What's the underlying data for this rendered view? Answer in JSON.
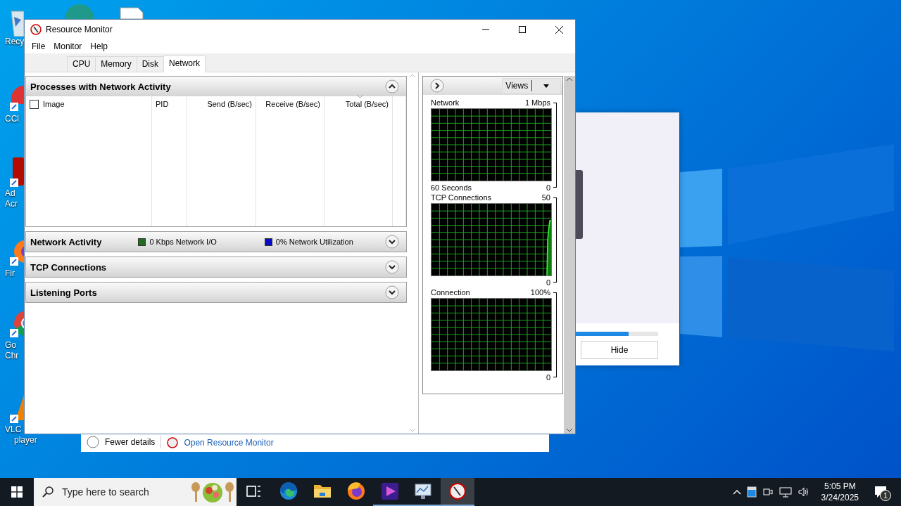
{
  "desktop_icons": [
    {
      "kind": "recycle",
      "lines": [
        "Recy"
      ]
    },
    {
      "kind": "ccleaner",
      "lines": [
        "CCl"
      ]
    },
    {
      "kind": "acrobat",
      "lines": [
        "Ad",
        "Acr"
      ]
    },
    {
      "kind": "firefox",
      "lines": [
        "Fir"
      ]
    },
    {
      "kind": "chrome",
      "lines": [
        "Go",
        "Chr"
      ]
    },
    {
      "kind": "vlc",
      "lines": [
        "VLC",
        "player"
      ]
    }
  ],
  "task_manager": {
    "fewer_details": "Fewer details",
    "link": "Open Resource Monitor"
  },
  "popup": {
    "progress": {
      "level": 0.64
    },
    "hide_button": "Hide"
  },
  "window": {
    "title": "Resource Monitor",
    "menu": [
      "File",
      "Monitor",
      "Help"
    ],
    "tabs": [
      {
        "label": "CPU",
        "selected": false
      },
      {
        "label": "Memory",
        "selected": false
      },
      {
        "label": "Disk",
        "selected": false
      },
      {
        "label": "Network",
        "selected": true
      }
    ]
  },
  "sections": [
    {
      "title": "Processes with Network Activity",
      "expanded": true,
      "select_all_checked": false,
      "columns": [
        {
          "label": "Image",
          "sorted": false
        },
        {
          "label": "PID",
          "sorted": false
        },
        {
          "label": "Send (B/sec)",
          "sorted": false
        },
        {
          "label": "Receive (B/sec)",
          "sorted": false
        },
        {
          "label": "Total (B/sec)",
          "sorted": true
        }
      ]
    },
    {
      "title": "Network Activity",
      "expanded": false,
      "legend": [
        {
          "label": "0 Kbps Network I/O",
          "color": "#1f6b1f"
        },
        {
          "label": "0% Network Utilization",
          "color": "#0a0ac8"
        }
      ]
    },
    {
      "title": "TCP Connections",
      "expanded": false
    },
    {
      "title": "Listening Ports",
      "expanded": false
    }
  ],
  "graph_panel": {
    "views_button": "Views",
    "graphs": [
      {
        "title": "Network",
        "max": "1 Mbps",
        "footer": "60 Seconds",
        "min": "0",
        "kind": "flat"
      },
      {
        "title": "TCP Connections",
        "max": "50",
        "min": "0",
        "kind": "spike"
      },
      {
        "title": "Connection",
        "max": "100%",
        "min": "0",
        "kind": "flat"
      }
    ]
  },
  "taskbar": {
    "search_placeholder": "Type here to search",
    "apps": [
      {
        "kind": "taskview",
        "running": false,
        "selected": false
      },
      {
        "kind": "edge",
        "running": false,
        "selected": false
      },
      {
        "kind": "explorer",
        "running": false,
        "selected": false
      },
      {
        "kind": "firefox",
        "running": false,
        "selected": false
      },
      {
        "kind": "media",
        "running": true,
        "selected": false
      },
      {
        "kind": "perfmon",
        "running": true,
        "selected": false
      },
      {
        "kind": "resmon",
        "running": true,
        "selected": true
      }
    ],
    "time": "5:05 PM",
    "date": "3/24/2025",
    "notification_count": "1"
  }
}
